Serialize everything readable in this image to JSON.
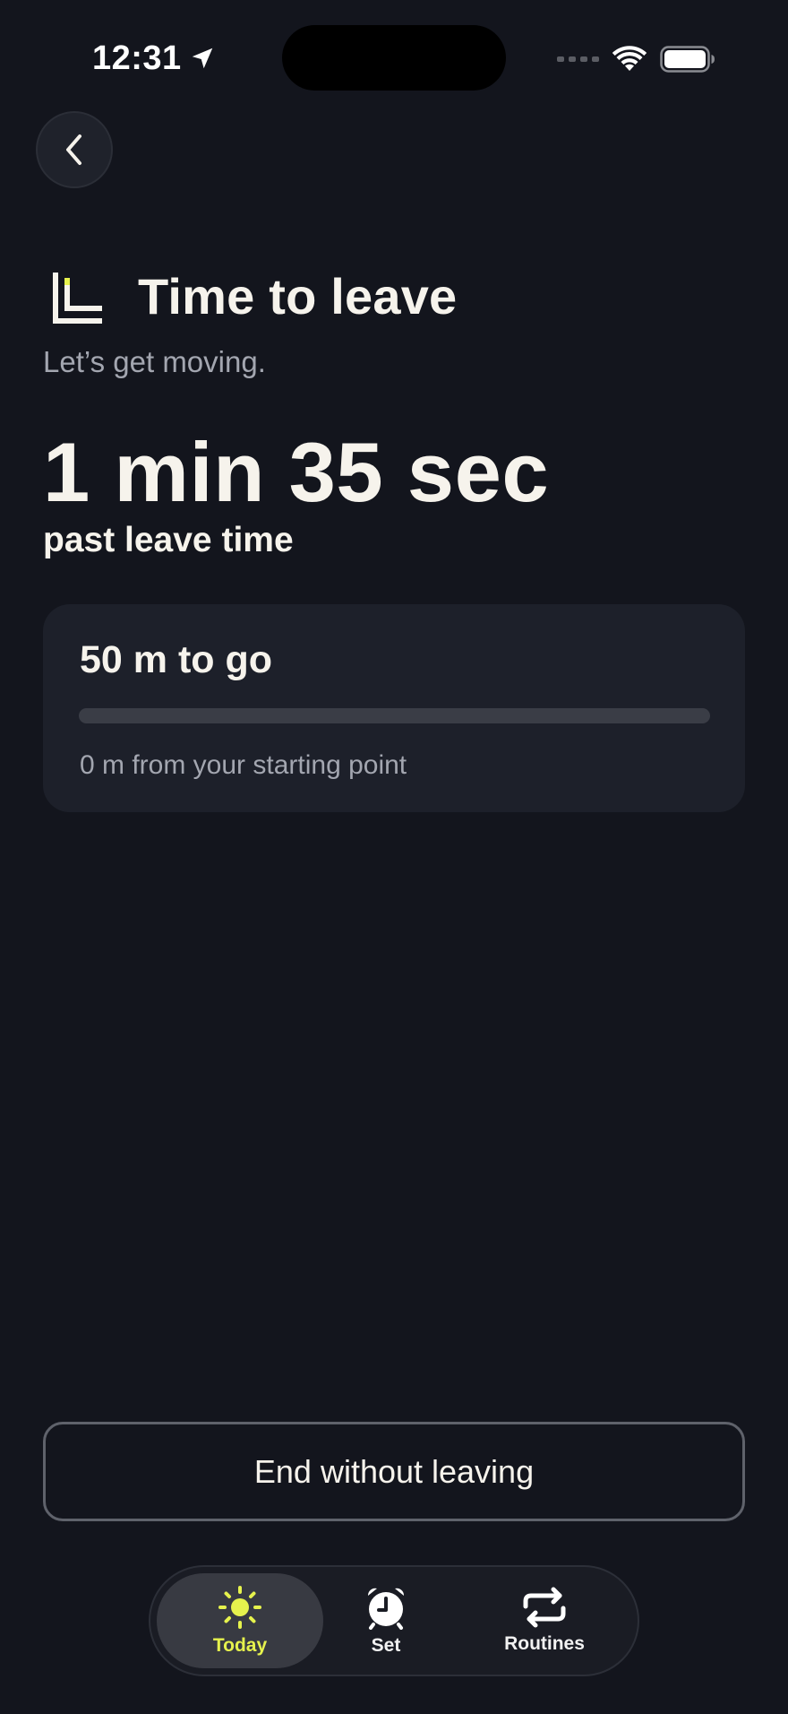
{
  "status_bar": {
    "time": "12:31"
  },
  "header": {
    "title": "Time to leave",
    "subtitle": "Let’s get moving."
  },
  "countdown": {
    "value": "1 min 35 sec",
    "caption": "past leave time"
  },
  "distance_card": {
    "title": "50 m to go",
    "progress_fraction": 0,
    "detail": "0 m from your starting point"
  },
  "actions": {
    "end_label": "End without leaving"
  },
  "tab_bar": {
    "tabs": [
      {
        "label": "Today",
        "icon": "sun-icon",
        "active": true
      },
      {
        "label": "Set",
        "icon": "alarm-clock-icon",
        "active": false
      },
      {
        "label": "Routines",
        "icon": "repeat-icon",
        "active": false
      }
    ]
  },
  "colors": {
    "background": "#13151d",
    "card": "#1d202a",
    "accent": "#e6f24d",
    "text_primary": "#f6f3ec",
    "text_secondary": "#a3a6b0"
  }
}
